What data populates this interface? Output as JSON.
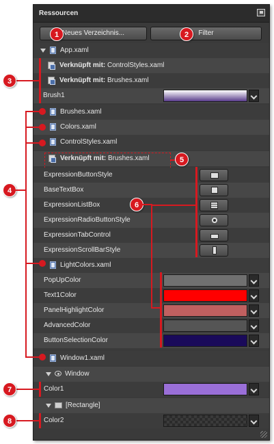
{
  "panel": {
    "title": "Ressourcen"
  },
  "toolbar": {
    "new_folder_label": "Neues Verzeichnis...",
    "filter_label": "Filter"
  },
  "rows": {
    "app": "App.xaml",
    "linked_label": "Verknüpft mit:",
    "linked1": "ControlStyles.xaml",
    "linked2": "Brushes.xaml",
    "brush1": "Brush1",
    "brushes": "Brushes.xaml",
    "colors": "Colors.xaml",
    "controlstyles": "ControlStyles.xaml",
    "linked3": "Brushes.xaml",
    "styles": [
      "ExpressionButtonStyle",
      "BaseTextBox",
      "ExpressionListBox",
      "ExpressionRadioButtonStyle",
      "ExpressionTabControl",
      "ExpressionScrollBarStyle"
    ],
    "lightcolors": "LightColors.xaml",
    "colors_list": [
      "PopUpColor",
      "Text1Color",
      "PanelHighlightColor",
      "AdvancedColor",
      "ButtonSelectionColor"
    ],
    "window1": "Window1.xaml",
    "window": "Window",
    "color1": "Color1",
    "rectangle": "[Rectangle]",
    "color2": "Color2"
  },
  "swatch_colors": {
    "brush1": [
      "#ffffff",
      "#5a3d8c"
    ],
    "PopUpColor": "#707070",
    "Text1Color": "#ff0000",
    "PanelHighlightColor": "#c06060",
    "AdvancedColor": "#555555",
    "ButtonSelectionColor": "#1a0a5a",
    "Color1": "#9a6fd8",
    "accent": "#d71920"
  },
  "callouts": [
    "1",
    "2",
    "3",
    "4",
    "5",
    "6",
    "7",
    "8"
  ]
}
